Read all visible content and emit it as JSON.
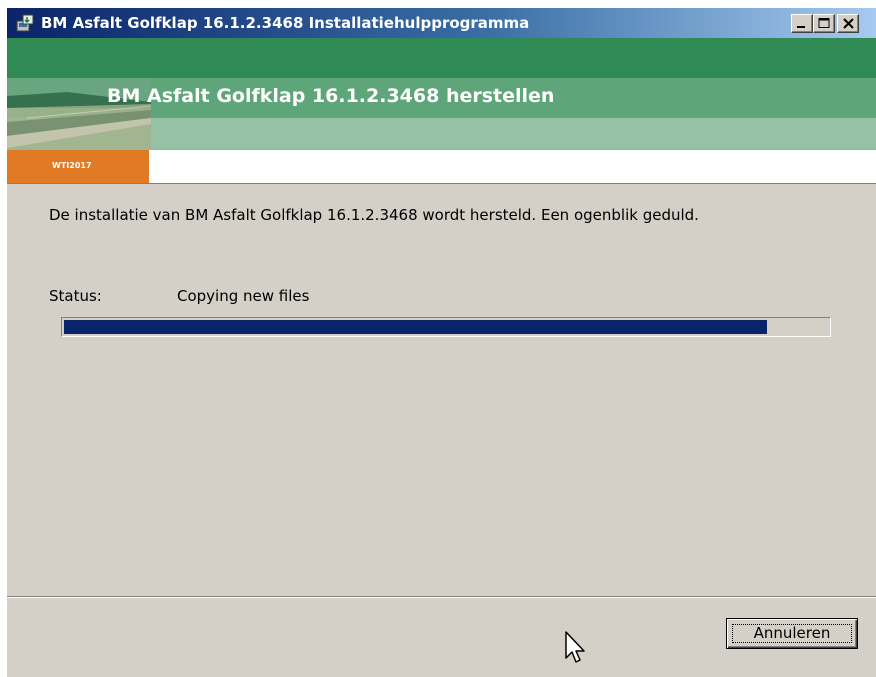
{
  "window": {
    "title": "BM Asfalt Golfklap 16.1.2.3468 Installatiehulpprogramma",
    "icon": "installer-icon",
    "caption_buttons": [
      "minimize-icon",
      "maximize-icon",
      "close-icon"
    ]
  },
  "banner": {
    "title": "BM Asfalt Golfklap 16.1.2.3468 herstellen",
    "logo_text": "WTI2017",
    "colors": {
      "band_dark": "#2f8a53",
      "band_mid": "#5fa57a",
      "band_light": "#95c2a4",
      "logo_tab": "#e07a25"
    }
  },
  "main": {
    "description": "De installatie van BM Asfalt Golfklap 16.1.2.3468 wordt hersteld. Een ogenblik geduld.",
    "status_label": "Status:",
    "status_value": "Copying new files",
    "progress": {
      "value": 0.92,
      "color": "#0a246a"
    }
  },
  "footer": {
    "cancel_label": "Annuleren"
  }
}
